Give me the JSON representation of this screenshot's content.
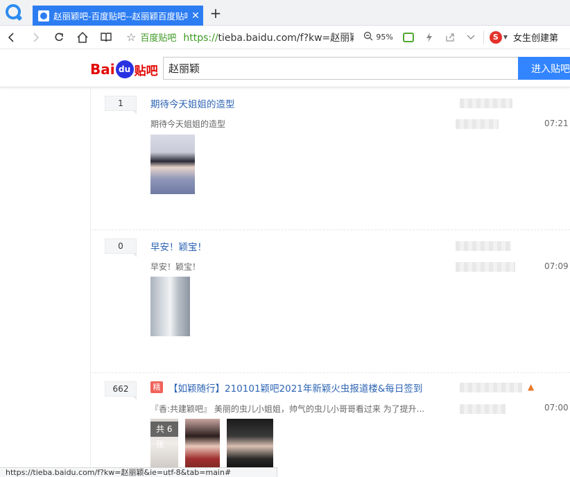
{
  "browser": {
    "tab_title": "赵丽颖吧-百度贴吧--赵丽颖百度贴吧",
    "tab_close": "✕",
    "new_tab": "+",
    "site_name": "百度贴吧",
    "url_proto": "https://",
    "url_rest": "tieba.baidu.com/f?kw=赵丽颖",
    "zoom": "95%",
    "news_text": "女生创建第",
    "status_url": "https://tieba.baidu.com/f?kw=赵丽颖&ie=utf-8&tab=main#"
  },
  "header": {
    "logo_bai": "Bai",
    "logo_du": "du",
    "logo_tieba": "贴吧",
    "search_value": "赵丽颖",
    "search_button": "进入贴吧"
  },
  "threads": [
    {
      "reply_count": "1",
      "title": "期待今天姐姐的造型",
      "abstract": "期待今天姐姐的造型",
      "time": "07:21"
    },
    {
      "reply_count": "0",
      "title": "早安！颖宝！",
      "abstract": "早安！颖宝！",
      "time": "07:09"
    },
    {
      "reply_count": "662",
      "badge": "精",
      "title": "【如颖随行】210101颖吧2021年新颖火虫报道楼&每日签到",
      "abstract": "『香:共建颖吧』 美丽的虫儿小姐姐，帅气的虫儿小哥哥看过来 为了提升...",
      "time": "07:00",
      "image_count": "共 6 张"
    }
  ],
  "colors": {
    "tab_blue": "#2d7df2",
    "link_blue": "#2d64b3",
    "search_blue": "#3385ff",
    "secure_green": "#3c9a22",
    "badge_red": "#f0625a"
  }
}
